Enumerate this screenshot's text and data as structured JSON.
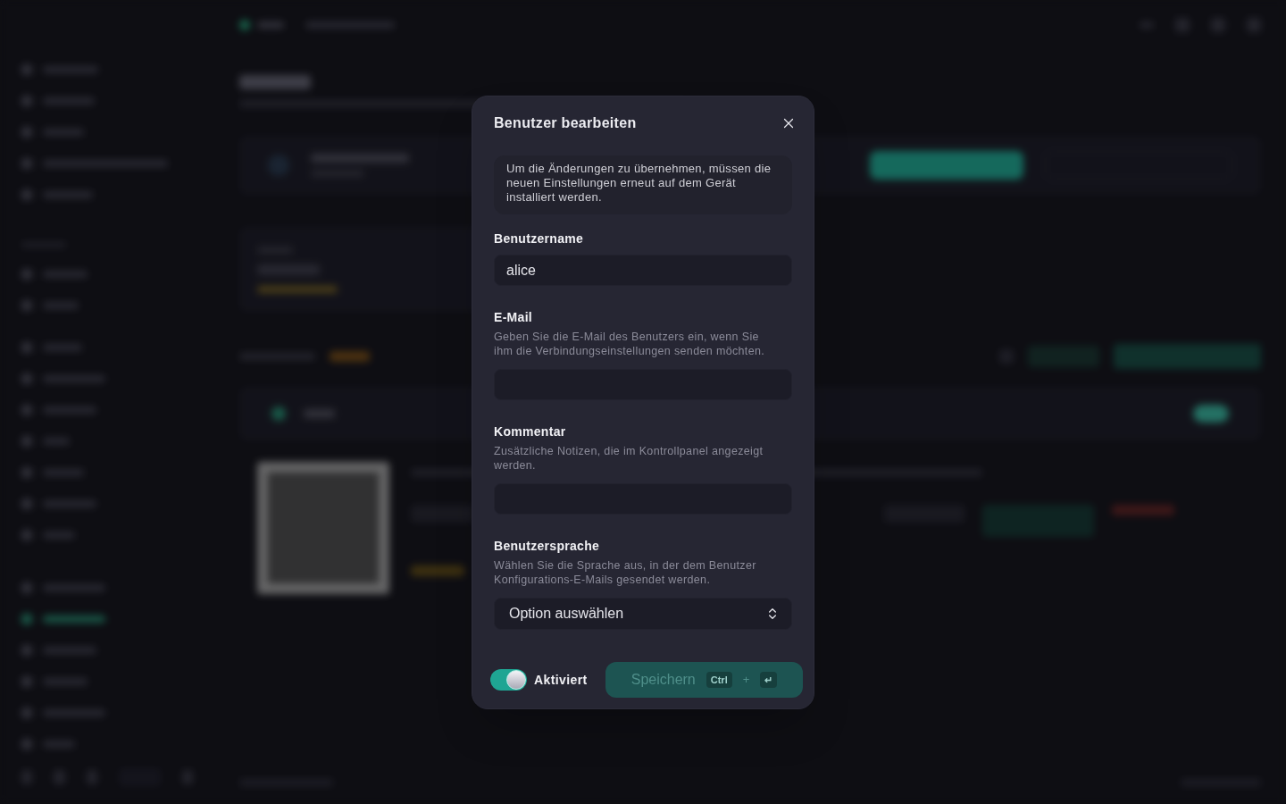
{
  "dialog": {
    "title": "Benutzer bearbeiten",
    "notice": "Um die Änderungen zu übernehmen, müssen die neuen Einstellungen erneut auf dem Gerät installiert werden.",
    "fields": [
      {
        "kind": "text",
        "label": "Benutzername",
        "value": "alice"
      },
      {
        "kind": "text",
        "label": "E-Mail",
        "help": "Geben Sie die E-Mail des Benutzers ein, wenn Sie ihm die Verbindungseinstellungen senden möchten."
      },
      {
        "kind": "text",
        "label": "Kommentar",
        "help": "Zusätzliche Notizen, die im Kontrollpanel angezeigt werden."
      },
      {
        "kind": "select",
        "label": "Benutzersprache",
        "help": "Wählen Sie die Sprache aus, in der dem Benutzer Konfigurations-E-Mails gesendet werden.",
        "placeholder": "Option auswählen"
      }
    ],
    "enabled_toggle": {
      "label": "Aktiviert",
      "on": true
    },
    "save_button": {
      "label": "Speichern",
      "disabled": true,
      "shortcut": [
        {
          "kind": "key",
          "text": "Ctrl"
        },
        {
          "kind": "separator",
          "text": "+"
        },
        {
          "kind": "key",
          "text": "↵"
        }
      ]
    }
  }
}
